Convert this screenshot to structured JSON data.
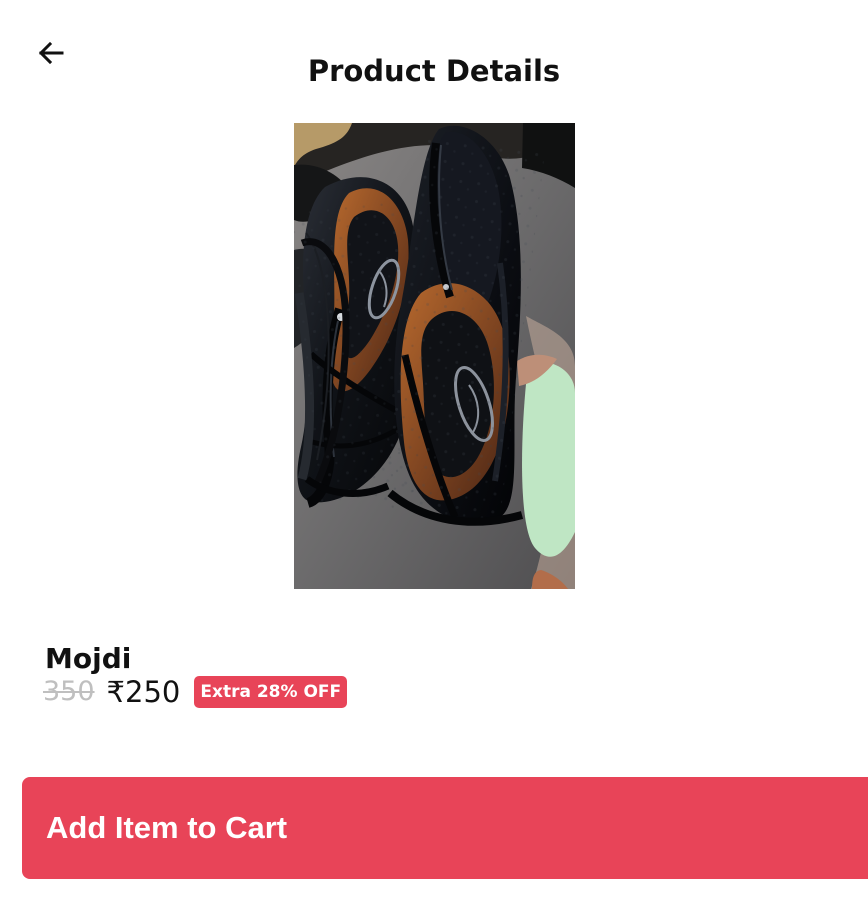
{
  "header": {
    "title": "Product Details",
    "back_icon": "arrow-left-icon"
  },
  "product": {
    "name": "Mojdi",
    "original_price": "350",
    "current_price": "₹250",
    "discount_badge": "Extra 28% OFF",
    "image_label": "Mojdi"
  },
  "actions": {
    "add_to_cart": "Add Item to Cart"
  },
  "colors": {
    "accent": "#e84458",
    "text": "#111111",
    "muted_price": "#bfbfbf",
    "background": "#ffffff"
  }
}
